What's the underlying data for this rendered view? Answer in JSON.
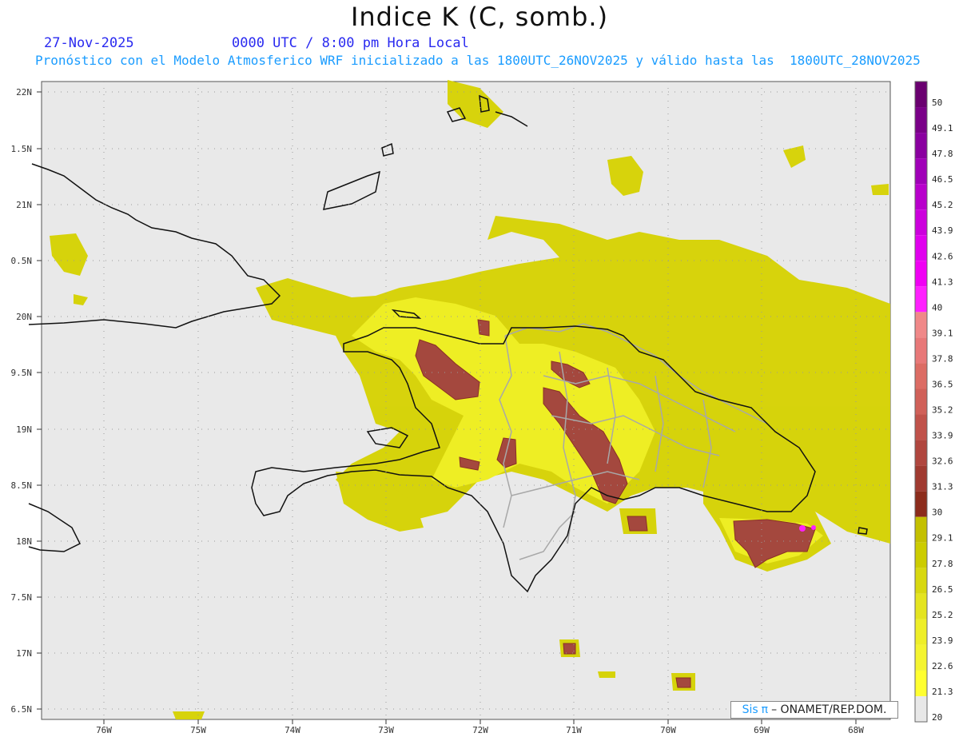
{
  "title": "Indice K (C, somb.)",
  "subtitle_date": "27-Nov-2025",
  "subtitle_time": "0000 UTC / 8:00 pm Hora Local",
  "subtitle_model": "Pronóstico con el Modelo Atmosferico WRF inicializado a las 1800UTC_26NOV2025 y válido hasta las  1800UTC_28NOV2025",
  "lat_labels": [
    "22N",
    "1.5N",
    "21N",
    "0.5N",
    "20N",
    "9.5N",
    "19N",
    "8.5N",
    "18N",
    "7.5N",
    "17N",
    "6.5N"
  ],
  "lon_labels": [
    "76W",
    "75W",
    "74W",
    "73W",
    "72W",
    "71W",
    "70W",
    "69W",
    "68W"
  ],
  "colorbar": {
    "labels": [
      "50",
      "49.1",
      "47.8",
      "46.5",
      "45.2",
      "43.9",
      "42.6",
      "41.3",
      "40",
      "39.1",
      "37.8",
      "36.5",
      "35.2",
      "33.9",
      "32.6",
      "31.3",
      "30",
      "29.1",
      "27.8",
      "26.5",
      "25.2",
      "23.9",
      "22.6",
      "21.3",
      "20"
    ],
    "colors": [
      "#6a0070",
      "#7a0088",
      "#8a00a0",
      "#a000b8",
      "#b800cc",
      "#cc00dd",
      "#e000ee",
      "#f000f4",
      "#ff20ff",
      "#f08888",
      "#e87878",
      "#dc6c64",
      "#d06058",
      "#c0524a",
      "#b0463e",
      "#a03a30",
      "#8c2c1c",
      "#c4c000",
      "#cccc00",
      "#d8d810",
      "#e4e420",
      "#eeee28",
      "#f4f430",
      "#ffff30",
      "#e8e8e8"
    ]
  },
  "credit": {
    "brand": "Sis",
    "pi": "π",
    "text": "– ONAMET/REP.DOM."
  },
  "colors": {
    "map_bg": "#e6e6e6",
    "coast": "#111111",
    "borders": "#a8a8a8",
    "low": "#d4d000",
    "mid": "#f0f020",
    "high": "#a04238"
  }
}
